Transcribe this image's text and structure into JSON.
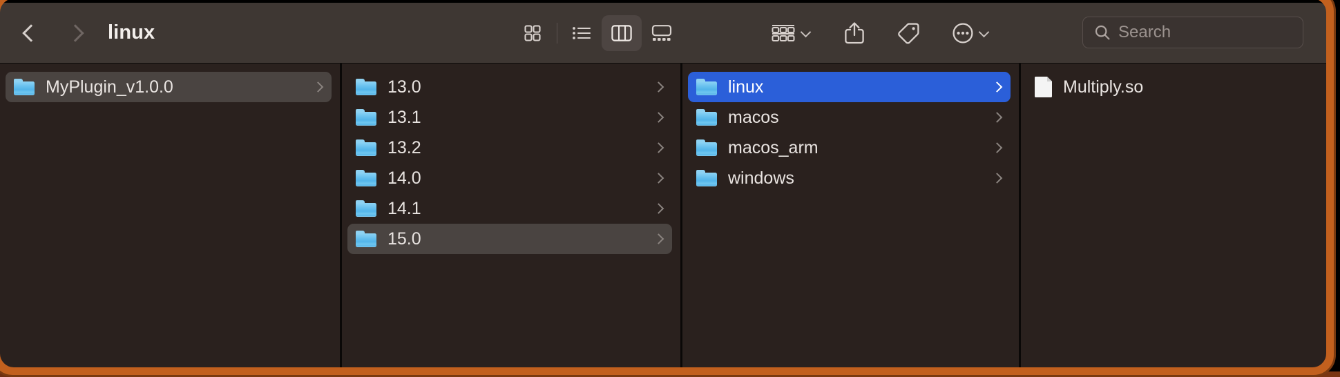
{
  "window": {
    "title": "linux",
    "accent_selection": "#2B5FD9",
    "inactive_selection": "#4A4441",
    "toolbar_bg": "#3E3733",
    "content_bg": "#2A211E",
    "frame_color": "#C2601E"
  },
  "toolbar": {
    "back_icon": "chevron-left-icon",
    "forward_icon": "chevron-right-icon",
    "view_modes": [
      {
        "name": "icon-view",
        "icon": "grid-icon",
        "active": false
      },
      {
        "name": "list-view",
        "icon": "list-icon",
        "active": false
      },
      {
        "name": "column-view",
        "icon": "columns-icon",
        "active": true
      },
      {
        "name": "gallery-view",
        "icon": "gallery-icon",
        "active": false
      }
    ],
    "tools": [
      {
        "name": "group-by-button",
        "icon": "group-icon",
        "has_caret": true
      },
      {
        "name": "share-button",
        "icon": "share-icon",
        "has_caret": false
      },
      {
        "name": "tag-button",
        "icon": "tag-icon",
        "has_caret": false
      },
      {
        "name": "more-options-button",
        "icon": "ellipsis-circle-icon",
        "has_caret": true
      }
    ]
  },
  "search": {
    "icon": "search-icon",
    "placeholder": "Search",
    "value": ""
  },
  "columns": [
    {
      "name": "column-1",
      "items": [
        {
          "label": "MyPlugin_v1.0.0",
          "icon": "folder-icon",
          "state": "selected-inactive",
          "disclosure": true
        }
      ]
    },
    {
      "name": "column-2",
      "items": [
        {
          "label": "13.0",
          "icon": "folder-icon",
          "state": "normal",
          "disclosure": true
        },
        {
          "label": "13.1",
          "icon": "folder-icon",
          "state": "normal",
          "disclosure": true
        },
        {
          "label": "13.2",
          "icon": "folder-icon",
          "state": "normal",
          "disclosure": true
        },
        {
          "label": "14.0",
          "icon": "folder-icon",
          "state": "normal",
          "disclosure": true
        },
        {
          "label": "14.1",
          "icon": "folder-icon",
          "state": "normal",
          "disclosure": true
        },
        {
          "label": "15.0",
          "icon": "folder-icon",
          "state": "selected-inactive",
          "disclosure": true
        }
      ]
    },
    {
      "name": "column-3",
      "items": [
        {
          "label": "linux",
          "icon": "folder-icon",
          "state": "selected-active",
          "disclosure": true
        },
        {
          "label": "macos",
          "icon": "folder-icon",
          "state": "normal",
          "disclosure": true
        },
        {
          "label": "macos_arm",
          "icon": "folder-icon",
          "state": "normal",
          "disclosure": true
        },
        {
          "label": "windows",
          "icon": "folder-icon",
          "state": "normal",
          "disclosure": true
        }
      ]
    },
    {
      "name": "column-4",
      "items": [
        {
          "label": "Multiply.so",
          "icon": "document-icon",
          "state": "normal",
          "disclosure": false
        }
      ]
    }
  ]
}
